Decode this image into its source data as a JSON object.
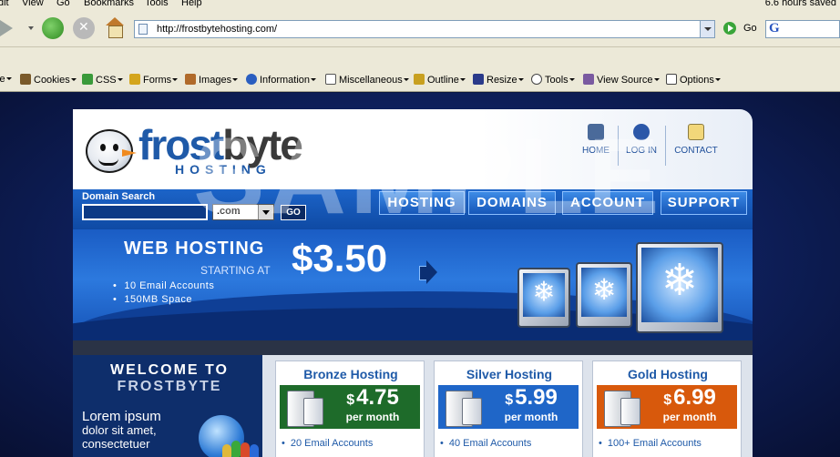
{
  "browser": {
    "menu": [
      "dit",
      "View",
      "Go",
      "Bookmarks",
      "Tools",
      "Help"
    ],
    "saved_status": "6.6 hours saved",
    "address": "http://frostbytehosting.com/",
    "go_label": "Go",
    "google_glyph": "G",
    "webdev_toolbar": [
      {
        "label": "le",
        "icon": "disable-icon"
      },
      {
        "label": "Cookies",
        "icon": "cookie-icon",
        "color": "#7a5a2a"
      },
      {
        "label": "CSS",
        "icon": "css-icon",
        "color": "#3a9a3a"
      },
      {
        "label": "Forms",
        "icon": "lock-icon",
        "color": "#d4a51c"
      },
      {
        "label": "Images",
        "icon": "images-icon",
        "color": "#b06a2a"
      },
      {
        "label": "Information",
        "icon": "info-icon",
        "color": "#2a5ec0"
      },
      {
        "label": "Miscellaneous",
        "icon": "misc-icon",
        "color": "#555555"
      },
      {
        "label": "Outline",
        "icon": "pencil-icon",
        "color": "#c8a020"
      },
      {
        "label": "Resize",
        "icon": "resize-icon",
        "color": "#2a3a8a"
      },
      {
        "label": "Tools",
        "icon": "tools-icon",
        "color": "#444444"
      },
      {
        "label": "View Source",
        "icon": "source-icon",
        "color": "#7a5aa0"
      },
      {
        "label": "Options",
        "icon": "options-icon",
        "color": "#444444"
      }
    ]
  },
  "site": {
    "logo_frost": "frost",
    "logo_byte": "byte",
    "logo_hosting": "HOSTING",
    "watermark": "SAMPLE",
    "top_links": [
      {
        "label": "HOME",
        "icon": "home-icon"
      },
      {
        "label": "LOG IN",
        "icon": "user-icon"
      },
      {
        "label": "CONTACT",
        "icon": "contact-icon"
      }
    ],
    "domain_search": {
      "label": "Domain Search",
      "value": "",
      "tld": ".com",
      "go": "GO"
    },
    "nav_tabs": [
      "HOSTING",
      "DOMAINS",
      "ACCOUNT",
      "SUPPORT"
    ],
    "banner": {
      "title": "WEB HOSTING",
      "starting_at": "STARTING AT",
      "price": "$3.50",
      "features": [
        "10 Email Accounts",
        "150MB Space"
      ],
      "flake": "❄"
    },
    "welcome": {
      "line1": "WELCOME TO",
      "line2": "FROSTBYTE",
      "text_lead": "Lorem ipsum",
      "text_lines": [
        "dolor sit amet,",
        "consectetuer"
      ]
    },
    "plans": [
      {
        "title": "Bronze Hosting",
        "currency": "$",
        "price": "4.75",
        "per": "per month",
        "feature": "20 Email Accounts",
        "color": "#1e6b2a"
      },
      {
        "title": "Silver Hosting",
        "currency": "$",
        "price": "5.99",
        "per": "per month",
        "feature": "40 Email Accounts",
        "color": "#1f66c8"
      },
      {
        "title": "Gold Hosting",
        "currency": "$",
        "price": "6.99",
        "per": "per month",
        "feature": "100+ Email Accounts",
        "color": "#d8590c"
      }
    ]
  }
}
